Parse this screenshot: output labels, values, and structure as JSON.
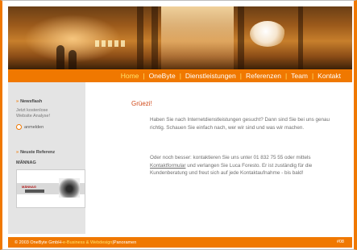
{
  "nav": {
    "items": [
      {
        "label": "Home",
        "active": true
      },
      {
        "label": "OneByte",
        "active": false
      },
      {
        "label": "Dienstleistungen",
        "active": false
      },
      {
        "label": "Referenzen",
        "active": false
      },
      {
        "label": "Team",
        "active": false
      },
      {
        "label": "Kontakt",
        "active": false
      }
    ],
    "separator": "|"
  },
  "sidebar": {
    "newsflash": {
      "title": "Newsflash",
      "lines": [
        "Jetzt kostenlose",
        "Website Analyse!"
      ],
      "register_label": "anmelden"
    },
    "reference": {
      "title": "Neuste Referenz",
      "client": "MÄNNAG",
      "thumb_logo": "MÄNNAG"
    }
  },
  "content": {
    "greeting": "Grüezi!",
    "paragraph1": "Haben Sie nach Internetdienstleistungen gesucht? Dann sind Sie bei uns genau richtig. Schauen Sie einfach nach, wer wir sind und was wir machen.",
    "paragraph2_before": "Oder noch besser: kontaktieren Sie uns unter 01 832 75 55 oder mittels ",
    "paragraph2_link": "Kontaktformular",
    "paragraph2_after": " und verlangen Sie Luca Foresto. Er ist zuständig für die Kundenberatung und freut sich auf jede Kontaktaufnahme - bis bald!"
  },
  "footer": {
    "copyright": "© 2003 OneByte GmbH",
    "sep1": " - ",
    "tagline": "e-Business & Webdesign",
    "sep2": " | ",
    "link": "Panoramen",
    "hits": "#08"
  },
  "colors": {
    "accent": "#f07800",
    "highlight": "#ffe36a",
    "greeting": "#d04a1a",
    "sidebar_bg": "#e4e4e4"
  },
  "icons": {
    "radio": "radio-circle-icon",
    "bullet": "double-chevron-bullet"
  }
}
